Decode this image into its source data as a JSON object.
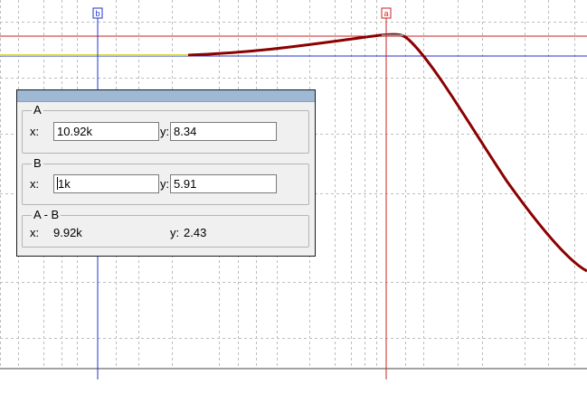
{
  "cursors": {
    "a": {
      "marker_label": "a",
      "color": "#cc2222"
    },
    "b": {
      "marker_label": "b",
      "color": "#2233cc"
    }
  },
  "colors": {
    "curve": "#8b0000",
    "baseline": "#d4dc3c",
    "grid": "#bdbdbd",
    "axis": "#444444",
    "hline_a": "#cc2222",
    "hline_b": "#2233cc"
  },
  "panel": {
    "group_a": {
      "label": "A",
      "x_label": "x:",
      "x_value": "10.92k",
      "y_label": "y:",
      "y_value": "8.34"
    },
    "group_b": {
      "label": "B",
      "x_label": "x:",
      "x_value": "1k",
      "y_label": "y:",
      "y_value": "5.91"
    },
    "group_diff": {
      "label": "A - B",
      "x_label": "x:",
      "x_value": "9.92k",
      "y_label": "y:",
      "y_value": "2.43"
    }
  }
}
